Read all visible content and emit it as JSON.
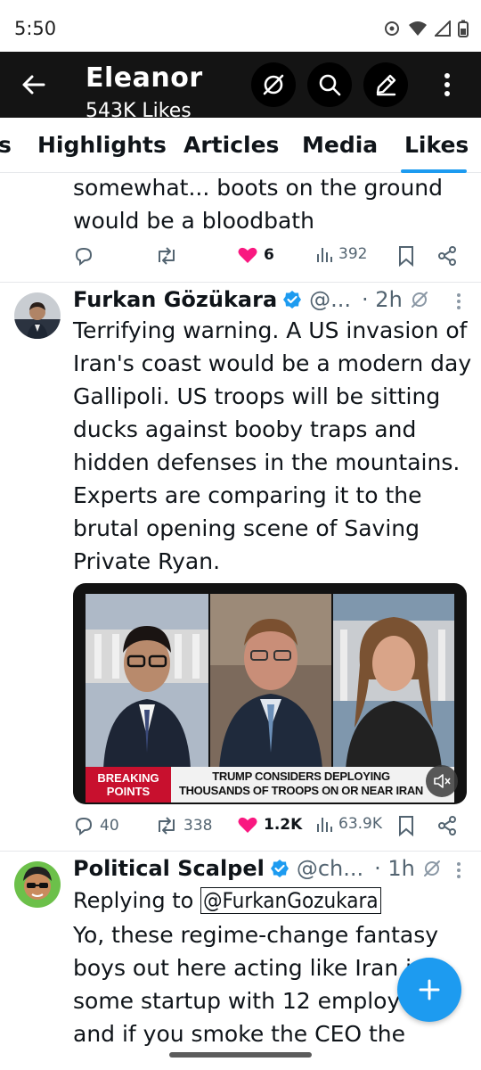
{
  "status_bar": {
    "time": "5:50"
  },
  "header": {
    "name": "Eleanor",
    "subtitle": "543K Likes"
  },
  "tabs": [
    {
      "label": "s"
    },
    {
      "label": "Highlights"
    },
    {
      "label": "Articles"
    },
    {
      "label": "Media"
    },
    {
      "label": "Likes",
      "selected": true
    }
  ],
  "tweets": [
    {
      "text_lines": [
        "somewhat... boots on the ground",
        "would be a bloodbath"
      ],
      "actions": {
        "replies": "",
        "reposts": "",
        "likes": "6",
        "views": "392"
      }
    },
    {
      "name": "Furkan Gözükara",
      "handle": "@...",
      "time": "· 2h",
      "text_lines": [
        "Terrifying warning. A US invasion of",
        "Iran's coast would be a modern day",
        "Gallipoli. US troops will be sitting",
        "ducks against booby traps and",
        "hidden defenses in the mountains.",
        "Experts are comparing it to the",
        "brutal opening scene of Saving",
        "Private Ryan."
      ],
      "media": {
        "banner_left": "BREAKING POINTS",
        "banner_text": "TRUMP CONSIDERS DEPLOYING THOUSANDS OF TROOPS ON OR NEAR IRAN"
      },
      "actions": {
        "replies": "40",
        "reposts": "338",
        "likes": "1.2K",
        "views": "63.9K"
      }
    },
    {
      "name": "Political Scalpel",
      "handle": "@ch...",
      "time": "· 1h",
      "replying_to_label": "Replying to",
      "replying_to_handle": "@FurkanGozukara",
      "text_lines": [
        "Yo, these regime-change fantasy",
        "boys out here acting like Iran is",
        "some startup with 12 employees",
        "and if you smoke the CEO the"
      ]
    }
  ],
  "colors": {
    "accent": "#1d9bf0",
    "like": "#f91880",
    "text": "#0f1419",
    "muted": "#536471",
    "header_bg": "#141414"
  },
  "icons": [
    "back-arrow-icon",
    "grok-icon",
    "search-icon",
    "edit-icon",
    "more-vert-icon",
    "reply-icon",
    "repost-icon",
    "heart-icon",
    "views-icon",
    "bookmark-icon",
    "share-icon",
    "verified-icon",
    "mute-icon",
    "plus-icon"
  ]
}
